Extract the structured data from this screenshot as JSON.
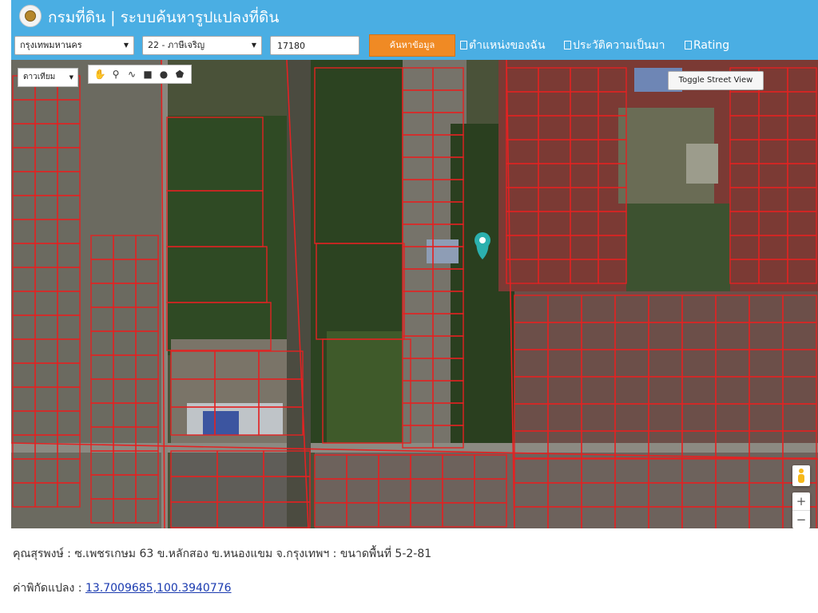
{
  "header": {
    "title": "กรมที่ดิน | ระบบค้นหารูปแปลงที่ดิน",
    "province": "กรุงเทพมหานคร",
    "district": "22 - ภาษีเจริญ",
    "parcel_number": "17180",
    "search_label": "ค้นหาข้อมูล",
    "checkbox_my_location": "ตำแหน่งของฉัน",
    "checkbox_history": "ประวัติความเป็นมา",
    "checkbox_rating": "Rating",
    "header_color": "#4aaee3",
    "search_color": "#f08a24"
  },
  "map": {
    "map_type": "ดาวเทียม",
    "street_view_label": "Toggle Street View",
    "zoom_in": "+",
    "zoom_out": "−",
    "icons": [
      "hand-icon",
      "marker-icon",
      "polyline-icon",
      "rectangle-icon",
      "circle-icon",
      "polygon-icon"
    ],
    "parcel_line_color": "#e32222"
  },
  "info": {
    "description": "คุณสุรพงษ์ : ซ.เพชรเกษม 63 ข.หลักสอง ข.หนองแขม จ.กรุงเทพฯ : ขนาดพื้นที่ 5-2-81",
    "coord_label": "ค่าพิกัดแปลง : ",
    "coordinates": "13.7009685,100.3940776"
  }
}
